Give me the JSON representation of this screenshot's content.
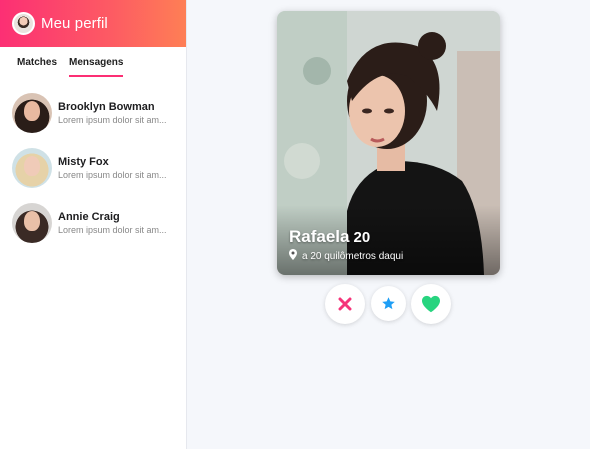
{
  "header": {
    "title": "Meu perfil"
  },
  "tabs": [
    {
      "label": "Matches",
      "active": false
    },
    {
      "label": "Mensagens",
      "active": true
    }
  ],
  "matches": [
    {
      "name": "Brooklyn Bowman",
      "preview": "Lorem ipsum dolor sit am..."
    },
    {
      "name": "Misty Fox",
      "preview": "Lorem ipsum dolor sit am..."
    },
    {
      "name": "Annie Craig",
      "preview": "Lorem ipsum dolor sit am..."
    }
  ],
  "card": {
    "name": "Rafaela",
    "age": "20",
    "distance": "a 20 quilômetros daqui"
  },
  "actions": {
    "nope_icon": "close-icon",
    "superlike_icon": "star-icon",
    "like_icon": "heart-icon"
  },
  "colors": {
    "brand_gradient_start": "#fc2f74",
    "brand_gradient_end": "#fe7f55",
    "nope": "#f5347a",
    "superlike": "#1e9ef5",
    "like": "#27d47f"
  }
}
